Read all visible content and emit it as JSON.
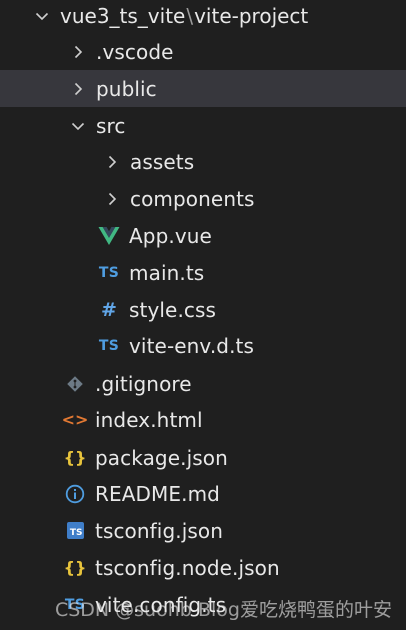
{
  "explorer": {
    "root": {
      "part1": "vue3_ts_vite",
      "separator": "\\",
      "part2": "vite-project"
    },
    "items": [
      {
        "label": ".vscode",
        "type": "folder",
        "state": "collapsed"
      },
      {
        "label": "public",
        "type": "folder",
        "state": "collapsed"
      },
      {
        "label": "src",
        "type": "folder",
        "state": "expanded"
      },
      {
        "label": "assets",
        "type": "folder",
        "state": "collapsed"
      },
      {
        "label": "components",
        "type": "folder",
        "state": "collapsed"
      },
      {
        "label": "App.vue",
        "type": "file",
        "icon": "vue-icon"
      },
      {
        "label": "main.ts",
        "type": "file",
        "icon": "typescript-icon",
        "icon_text": "TS"
      },
      {
        "label": "style.css",
        "type": "file",
        "icon": "css-hash-icon",
        "icon_text": "#"
      },
      {
        "label": "vite-env.d.ts",
        "type": "file",
        "icon": "typescript-icon",
        "icon_text": "TS"
      },
      {
        "label": ".gitignore",
        "type": "file",
        "icon": "git-icon"
      },
      {
        "label": "index.html",
        "type": "file",
        "icon": "html-icon",
        "icon_text": "<>"
      },
      {
        "label": "package.json",
        "type": "file",
        "icon": "json-icon",
        "icon_text": "{}"
      },
      {
        "label": "README.md",
        "type": "file",
        "icon": "info-icon"
      },
      {
        "label": "tsconfig.json",
        "type": "file",
        "icon": "tsconfig-icon",
        "icon_text": "TS"
      },
      {
        "label": "tsconfig.node.json",
        "type": "file",
        "icon": "json-icon",
        "icon_text": "{}"
      },
      {
        "label": "vite.config.ts",
        "type": "file",
        "icon": "typescript-icon",
        "icon_text": "TS"
      }
    ]
  },
  "watermark": "CSDN @suohb-Blog爱吃烧鸭蛋的叶安",
  "colors": {
    "background": "#1f1f1f",
    "hover_row": "#37373d",
    "vue_green": "#41b883",
    "ts_blue": "#4f9de0",
    "json_yellow": "#e8c43c",
    "html_orange": "#e37933"
  }
}
